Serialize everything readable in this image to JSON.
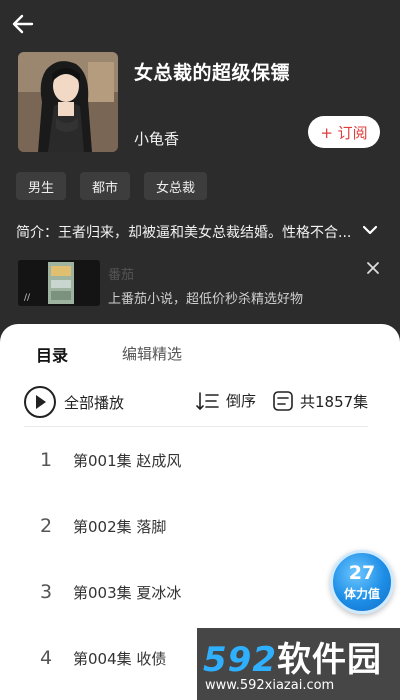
{
  "header": {
    "back_icon": "arrow-left-icon"
  },
  "book": {
    "title": "女总裁的超级保镖",
    "author": "小龟香",
    "subscribe_label": "+ 订阅",
    "tags": [
      "男生",
      "都市",
      "女总裁"
    ],
    "intro": "简介：王者归来，却被逼和美女总裁结婚。性格不合..."
  },
  "ad": {
    "title": "番茄",
    "description": "上番茄小说，超低价秒杀精选好物",
    "close_icon": "close-icon"
  },
  "sheet": {
    "tabs": [
      "目录",
      "编辑精选"
    ],
    "play_all_label": "全部播放",
    "sort_label": "倒序",
    "count_label": "共1857集",
    "episodes": [
      {
        "num": "1",
        "text": "第001集  赵成风"
      },
      {
        "num": "2",
        "text": "第002集  落脚"
      },
      {
        "num": "3",
        "text": "第003集  夏冰冰"
      },
      {
        "num": "4",
        "text": "第004集  收债"
      }
    ]
  },
  "stamina_badge": {
    "value": "27",
    "label": "体力值"
  },
  "watermark": {
    "logo_num": "592",
    "logo_text": "软件园",
    "url": "www.592xiazai.com"
  },
  "colors": {
    "accent_red": "#e03c3c",
    "badge_blue": "#1d8de6",
    "watermark_blue": "#2fb0ff"
  }
}
